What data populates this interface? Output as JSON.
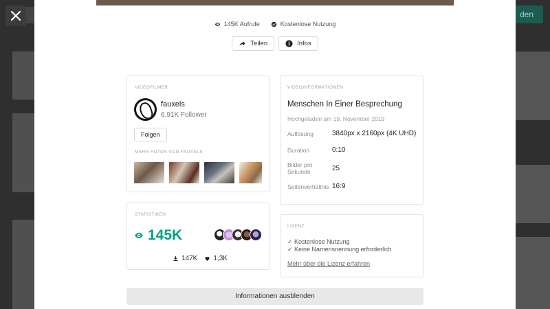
{
  "background": {
    "cta_label": "den"
  },
  "stats_row": {
    "views": "145K Aufrufe",
    "license": "Kostenlose Nutzung"
  },
  "actions": {
    "share": "Teilen",
    "info": "Infos"
  },
  "photographer": {
    "caption": "VIDEOFILMER",
    "name": "fauxels",
    "followers": "6,91K Follower",
    "follow_label": "Folgen",
    "more_caption": "MEHR FOTOS VON FAUXELS"
  },
  "stats": {
    "caption": "STATISTIKEN",
    "views_big": "145K",
    "downloads": "147K",
    "likes": "1,3K"
  },
  "video_info": {
    "caption": "VIDEOINFORMATIONEN",
    "title": "Menschen In Einer Besprechung",
    "uploaded": "Hochgeladen am 19. November 2019",
    "rows": [
      {
        "key": "Auflösung",
        "value": "3840px x 2160px (4K UHD)"
      },
      {
        "key": "Duration",
        "value": "0:10"
      },
      {
        "key": "Bilder pro Sekunde",
        "value": "25"
      },
      {
        "key": "Seitenverhältnis",
        "value": "16:9"
      }
    ]
  },
  "license": {
    "caption": "LIZENZ",
    "items": [
      "✓ Kostenlose Nutzung",
      "✓ Keine Namensnennung erforderlich"
    ],
    "link": "Mehr über die Lizenz erfahren"
  },
  "hide_bar": "Informationen ausblenden",
  "colors": {
    "accent": "#05a081",
    "overlay": "#2b2b2b",
    "card_border": "#e3e3e3"
  }
}
